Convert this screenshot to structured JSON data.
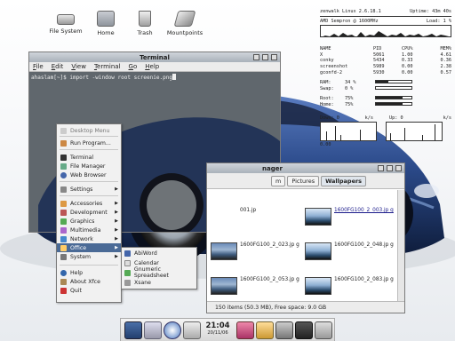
{
  "desktop": {
    "icons": [
      {
        "label": "File System"
      },
      {
        "label": "Home"
      },
      {
        "label": "Trash"
      },
      {
        "label": "Mountpoints"
      }
    ]
  },
  "conky": {
    "header_left": "zenwalk Linux 2.6.18.1",
    "header_right": "Uptime: 43m 40s",
    "cpu_line": "AMD Sempron @ 1600MHz",
    "load": "Load:  1  %",
    "proc_headers": [
      "NAME",
      "PID",
      "CPU%",
      "MEM%"
    ],
    "procs": [
      [
        "X",
        "5061",
        "1.00",
        "4.61"
      ],
      [
        "conky",
        "5434",
        "0.33",
        "0.36"
      ],
      [
        "screenshot",
        "5989",
        "0.00",
        "2.38"
      ],
      [
        "gconfd-2",
        "5930",
        "0.00",
        "0.57"
      ]
    ],
    "ram_label": "RAM:",
    "ram_pct": "34 %",
    "ram_value": 0.34,
    "swap_label": "Swap:",
    "swap_pct": "0  %",
    "swap_value": 0.0,
    "root_label": "Root:",
    "root_pct": "75%",
    "root_value": 0.75,
    "home_label": "Home:",
    "home_pct": "75%",
    "home_value": 0.75,
    "down_label": "Down: 0",
    "down_unit": "k/s",
    "up_label": "Up: 0",
    "up_unit": "k/s",
    "scale": "0.00"
  },
  "terminal": {
    "title": "Terminal",
    "menu": [
      "File",
      "Edit",
      "View",
      "Terminal",
      "Go",
      "Help"
    ],
    "prompt": "ahaslam[~]$ import -window root screenie.png"
  },
  "file_manager": {
    "title": "nager",
    "crumbs": [
      "m",
      "Pictures",
      "Wallpapers"
    ],
    "files": [
      {
        "name": "001.jp",
        "link": false
      },
      {
        "name": "1600FG100_2_003.jp g",
        "link": true
      },
      {
        "name": "1600FG100_2_023.jp g",
        "link": false
      },
      {
        "name": "1600FG100_2_048.jp g",
        "link": false
      },
      {
        "name": "1600FG100_2_053.jp g",
        "link": false
      },
      {
        "name": "1600FG100_2_083.jp g",
        "link": false
      }
    ],
    "status": "150 items (50.3 MB), Free space: 9.0 GB"
  },
  "desktop_menu": {
    "title": "Desktop Menu",
    "items": [
      {
        "label": "Run Program...",
        "submenu": false
      },
      {
        "label": "Terminal",
        "submenu": false
      },
      {
        "label": "File Manager",
        "submenu": false
      },
      {
        "label": "Web Browser",
        "submenu": false
      },
      {
        "label": "Settings",
        "submenu": true
      },
      {
        "label": "Accessories",
        "submenu": true
      },
      {
        "label": "Development",
        "submenu": true
      },
      {
        "label": "Graphics",
        "submenu": true
      },
      {
        "label": "Multimedia",
        "submenu": true
      },
      {
        "label": "Network",
        "submenu": true
      },
      {
        "label": "Office",
        "submenu": true
      },
      {
        "label": "System",
        "submenu": true
      },
      {
        "label": "Help",
        "submenu": false
      },
      {
        "label": "About Xfce",
        "submenu": false
      },
      {
        "label": "Quit",
        "submenu": false
      }
    ],
    "office_submenu": [
      "AbiWord",
      "Calendar",
      "Gnumeric Spreadsheet",
      "Xsane"
    ]
  },
  "panel": {
    "time": "21:04",
    "date": "20/11/06"
  },
  "colors": {
    "menu_highlight": "#4a6a96",
    "car_body": "#2b4a8a"
  }
}
